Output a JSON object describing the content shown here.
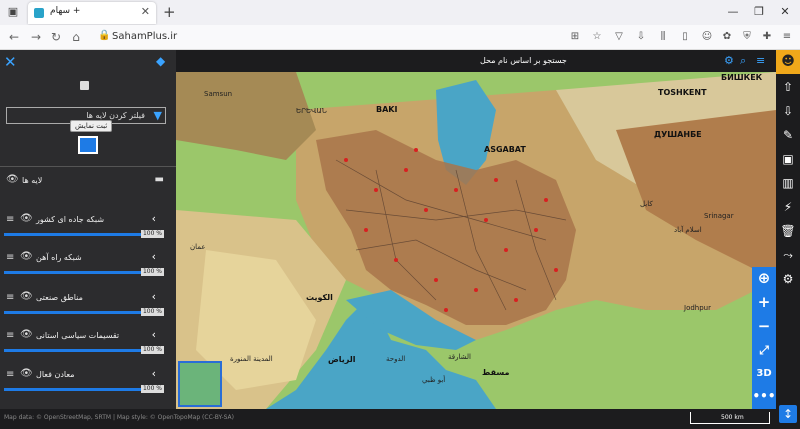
{
  "browser": {
    "tab_title": "سهام +",
    "tab_close": "✕",
    "new_tab": "+",
    "url": "SahamPlus.ir"
  },
  "panel": {
    "filter_placeholder": "فیلتر کردن لایه ها",
    "tooltip": "ثبت نمایش",
    "layers_title": "لایه ها",
    "layers": [
      {
        "name": "شبکه جاده ای کشور",
        "opacity": "100 %"
      },
      {
        "name": "شبکه راه آهن",
        "opacity": "100 %"
      },
      {
        "name": "مناطق صنعتی",
        "opacity": "100 %"
      },
      {
        "name": "تقسیمات سیاسی استانی",
        "opacity": "100 %"
      },
      {
        "name": "معادن فعال",
        "opacity": "100 %"
      }
    ]
  },
  "map": {
    "search_label": "جستجو بر اساس نام محل",
    "labels": {
      "baku": "BAKI",
      "asgabat": "ASGABAT",
      "toshkent": "TOSHKENT",
      "dushanbe": "ДУШАНБЕ",
      "bishkek": "БИШКЕК",
      "samsun": "Samsun",
      "karakol": "کابل",
      "srinagar": "Srinagar",
      "islamabad": "اسلام آباد",
      "amman": "عمان",
      "kuwait": "الكويت",
      "riyadh": "الرياض",
      "doha": "الدوحة",
      "muscat": "مسقط",
      "abudhabi": "أبو ظبي",
      "jodhpur": "Jodhpur",
      "madinah": "المدينة المنورة",
      "erevan": "ԵՐԵՎԱՆ",
      "sharjah": "الشارقة"
    },
    "zoom_3d": "3D",
    "scale": "500 km",
    "attribution": "Map data: © OpenStreetMap, SRTM | Map style: © OpenTopoMap (CC-BY-SA)"
  },
  "colors": {
    "accent": "#1e7be6",
    "panel_bg": "#2c2c2e",
    "user_button": "#f0a81a"
  }
}
